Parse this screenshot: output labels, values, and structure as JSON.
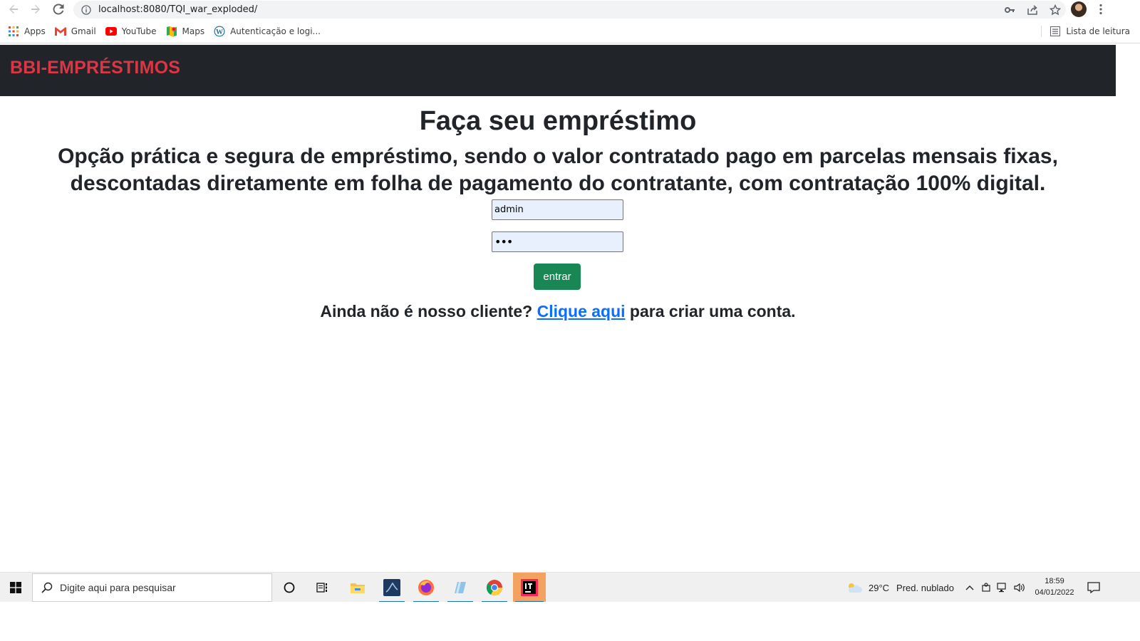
{
  "browser": {
    "url": "localhost:8080/TQI_war_exploded/",
    "bookmarks": [
      {
        "label": "Apps",
        "icon": "apps-grid-icon"
      },
      {
        "label": "Gmail",
        "icon": "gmail-icon"
      },
      {
        "label": "YouTube",
        "icon": "youtube-icon"
      },
      {
        "label": "Maps",
        "icon": "maps-icon"
      },
      {
        "label": "Autenticação e logi...",
        "icon": "wordpress-icon"
      }
    ],
    "reading_list": "Lista de leitura"
  },
  "site": {
    "brand": "BBI-EMPRÉSTIMOS",
    "heading": "Faça seu empréstimo",
    "subheading": "Opção prática e segura de empréstimo, sendo o valor contratado pago em parcelas mensais fixas, descontadas diretamente em folha de pagamento do contratante, com contratação 100% digital.",
    "login_value": "admin",
    "password_value": "•••",
    "submit_label": "entrar",
    "signup_prefix": "Ainda não é nosso cliente?",
    "signup_link": "Clique aqui",
    "signup_suffix": "para criar uma conta.",
    "colors": {
      "navbar": "#212529",
      "brand": "#dc3545",
      "button": "#198754",
      "link": "#0d6efd"
    }
  },
  "taskbar": {
    "search_placeholder": "Digite aqui para pesquisar",
    "weather_temp": "29°C",
    "weather_desc": "Pred. nublado",
    "time": "18:59",
    "date": "04/01/2022"
  }
}
